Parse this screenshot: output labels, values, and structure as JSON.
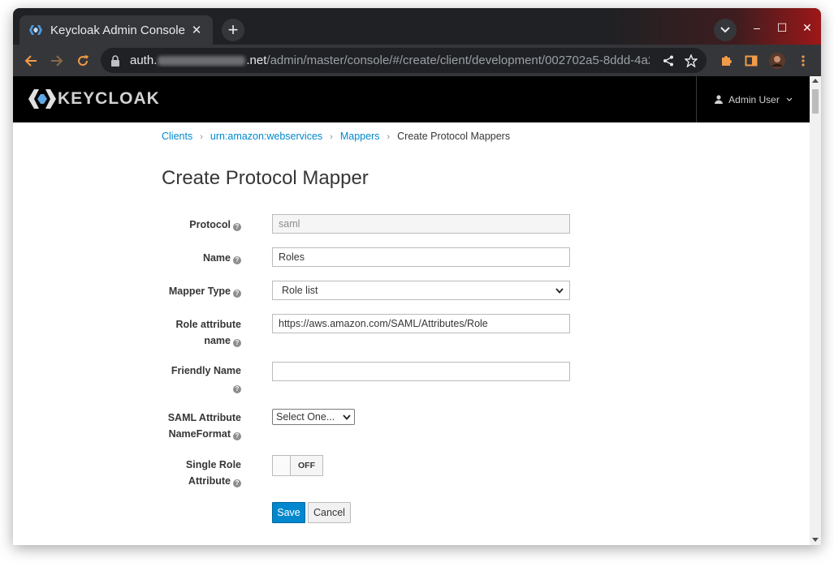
{
  "browser": {
    "tab_title": "Keycloak Admin Console",
    "tab_close": "✕",
    "new_tab": "+",
    "url_host_prefix": "auth.",
    "url_host_suffix": ".net",
    "url_path": "/admin/master/console/#/create/client/development/002702a5-8ddd-4a23-...",
    "window_controls": [
      "–",
      "☐",
      "✕"
    ]
  },
  "header": {
    "logo_text": "KEYCLOAK",
    "user_label": "Admin User",
    "user_caret": "⌄"
  },
  "breadcrumb": {
    "items": [
      "Clients",
      "urn:amazon:webservices",
      "Mappers"
    ],
    "current": "Create Protocol Mappers",
    "separator": "›"
  },
  "page": {
    "title": "Create Protocol Mapper"
  },
  "form": {
    "protocol": {
      "label": "Protocol",
      "value": "saml"
    },
    "name": {
      "label": "Name",
      "value": "Roles"
    },
    "mapper_type": {
      "label": "Mapper Type",
      "value": "Role list"
    },
    "role_attribute_name": {
      "label_line1": "Role attribute",
      "label_line2": "name",
      "value": "https://aws.amazon.com/SAML/Attributes/Role"
    },
    "friendly_name": {
      "label_line1": "Friendly Name",
      "value": ""
    },
    "saml_nameformat": {
      "label_line1": "SAML Attribute",
      "label_line2": "NameFormat",
      "value": "Select One..."
    },
    "single_role": {
      "label_line1": "Single Role",
      "label_line2": "Attribute",
      "state": "OFF"
    },
    "save_label": "Save",
    "cancel_label": "Cancel",
    "help_glyph": "?"
  },
  "colors": {
    "brand_blue": "#0088ce",
    "header_bg": "#000000",
    "chrome_dark": "#202124"
  }
}
